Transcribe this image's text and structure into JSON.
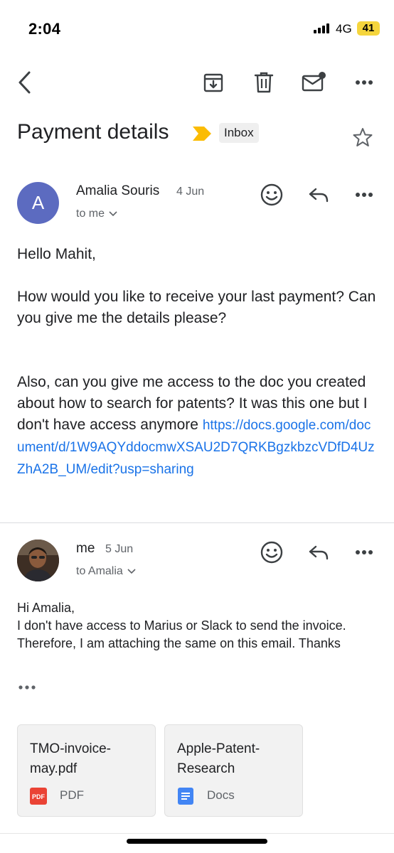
{
  "status_bar": {
    "time": "2:04",
    "network": "4G",
    "battery": "41"
  },
  "toolbar": {
    "back_icon": "chevron-left-icon",
    "archive_icon": "archive-icon",
    "delete_icon": "trash-icon",
    "mark_unread_icon": "mail-unread-icon",
    "more_icon": "more-horizontal-icon"
  },
  "thread": {
    "subject": "Payment details",
    "label": "Inbox",
    "label_color": "#fbbc04"
  },
  "messages": [
    {
      "avatar_letter": "A",
      "avatar_color": "#5c6bc0",
      "sender": "Amalia Souris",
      "date": "4 Jun",
      "recipient": "to me",
      "body": {
        "greeting": "Hello Mahit,",
        "para1": "How would you like to receive your last payment? Can you give me the details please?",
        "para2": "Also, can you give me access to the doc you created about how to search for patents? It was this one but I don't have access anymore",
        "link": "https://docs.google.com/document/d/1W9AQYddocmwXSAU2D7QRKBgzkbzcVDfD4UzZhA2B_UM/edit?usp=sharing"
      }
    },
    {
      "sender": "me",
      "date": "5 Jun",
      "recipient": "to Amalia",
      "body": {
        "greeting": "Hi Amalia,",
        "text": "I don't have access to Marius or Slack to send the invoice. Therefore, I am attaching the same on this email. Thanks"
      },
      "attachments": [
        {
          "name": "TMO-invoice-may.pdf",
          "type": "PDF",
          "icon": "pdf-icon"
        },
        {
          "name": "Apple-Patent-Research",
          "type": "Docs",
          "icon": "docs-icon"
        }
      ]
    }
  ]
}
